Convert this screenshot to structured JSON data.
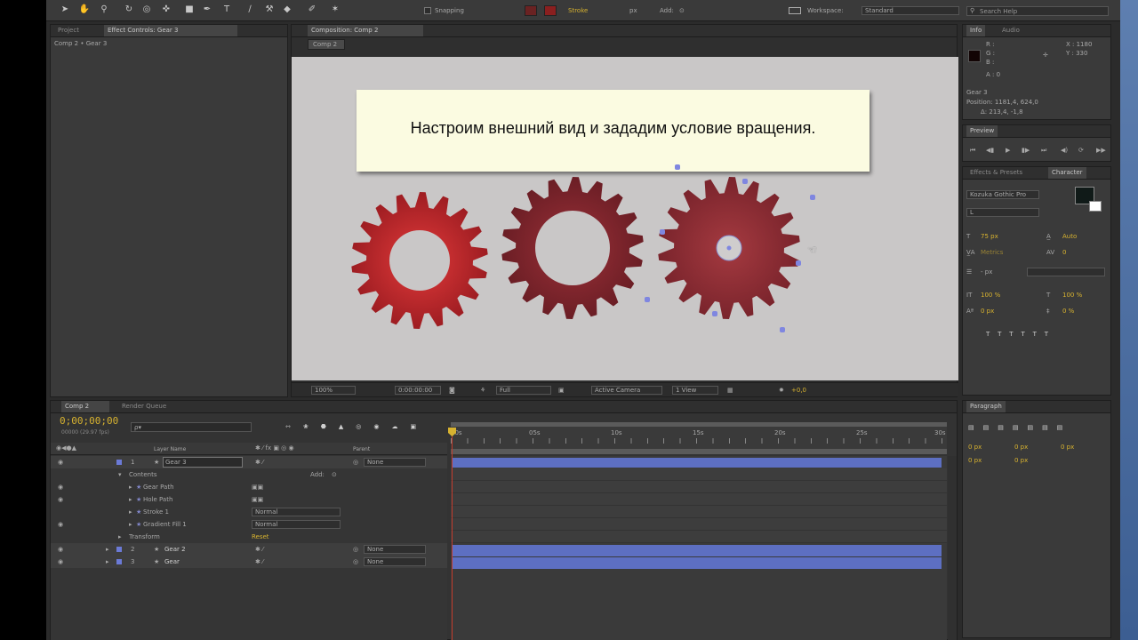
{
  "colors": {
    "accent": "#d7b230",
    "layer_bar": "#5d6fc2",
    "gear_red": "#b02a2e",
    "gear_dark": "#7a232a",
    "caption_bg": "#fbfbe1",
    "stage_bg": "#c9c7c7"
  },
  "toolbar": {
    "snapping_label": "Snapping",
    "add_label": "Add:",
    "workspace_label": "Workspace:",
    "workspace_value": "Standard",
    "search_placeholder": "Search Help",
    "stroke_label": "Stroke",
    "px_label": "px"
  },
  "project_panel": {
    "tab_project": "Project",
    "tab_effect": "Effect Controls: Gear 3",
    "breadcrumb": "Comp 2 • Gear 3"
  },
  "composition_panel": {
    "tab": "Composition: Comp 2",
    "subtab": "Comp 2",
    "caption": "Настроим внешний вид и зададим условие вращения.",
    "zoom": "100%",
    "timecode": "0:00:00:00",
    "resolution": "Full",
    "camera": "Active Camera",
    "views": "1 View",
    "exposure": "+0,0"
  },
  "info_panel": {
    "tab_info": "Info",
    "tab_audio": "Audio",
    "r": "R :",
    "g": "G :",
    "b": "B :",
    "a": "A : 0",
    "x": "X : 1180",
    "y": "Y : 330",
    "layer": "Gear 3",
    "position": "Position: 1181,4, 624,0",
    "delta": "Δ: 213,4, -1,8"
  },
  "preview_panel": {
    "tab": "Preview"
  },
  "character_panel": {
    "tab_effects": "Effects & Presets",
    "tab_character": "Character",
    "font": "Kozuka Gothic Pro",
    "style": "L",
    "size": "75 px",
    "leading": "Auto",
    "kerning": "Metrics",
    "tracking": "0",
    "stroke": "- px",
    "vscale": "100 %",
    "hscale": "100 %",
    "baseline": "0 px",
    "tsume": "0 %"
  },
  "paragraph_panel": {
    "tab": "Paragraph",
    "indent_left": "0 px",
    "indent_right": "0 px",
    "indent_first": "0 px",
    "space_before": "0 px",
    "space_after": "0 px"
  },
  "timeline": {
    "tab_comp": "Comp 2",
    "tab_render": "Render Queue",
    "timecode": "0;00;00;00",
    "fps": "00000 (29.97 fps)",
    "search_placeholder": "ρ▾",
    "col_layer_name": "Layer Name",
    "col_parent": "Parent",
    "ruler": [
      "00s",
      "05s",
      "10s",
      "15s",
      "20s",
      "25s",
      "30s"
    ],
    "layers": [
      {
        "num": "1",
        "name": "Gear 3",
        "parent": "None"
      },
      {
        "num": "2",
        "name": "Gear 2",
        "parent": "None"
      },
      {
        "num": "3",
        "name": "Gear",
        "parent": "None"
      }
    ],
    "contents_label": "Contents",
    "add_label": "Add:",
    "props": [
      {
        "name": "Gear Path",
        "mode": ""
      },
      {
        "name": "Hole Path",
        "mode": ""
      },
      {
        "name": "Stroke 1",
        "mode": "Normal"
      },
      {
        "name": "Gradient Fill 1",
        "mode": "Normal"
      }
    ],
    "transform_label": "Transform",
    "transform_reset": "Reset"
  }
}
